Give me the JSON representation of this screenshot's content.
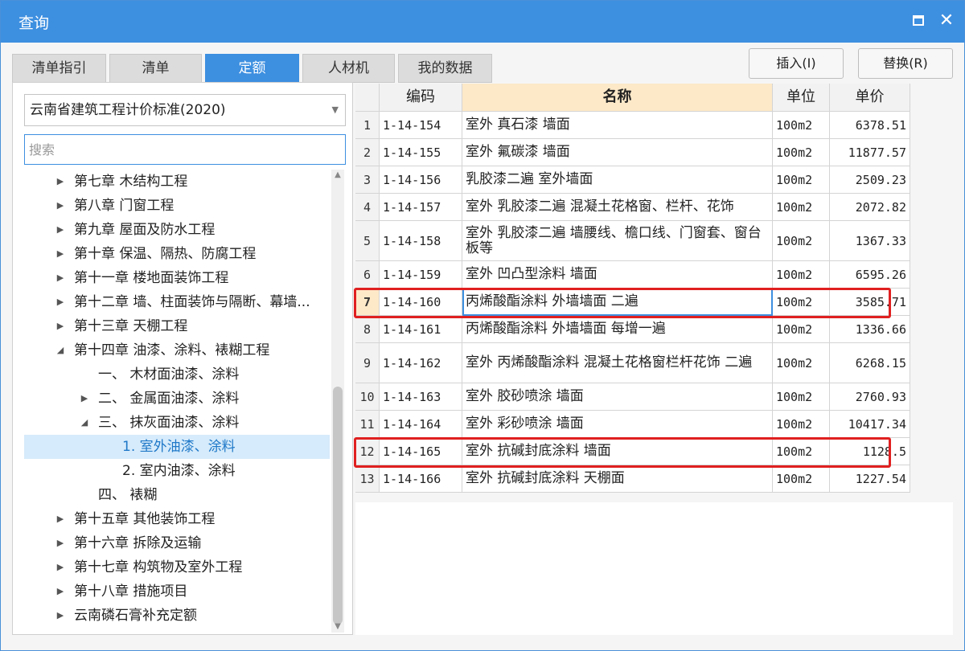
{
  "window": {
    "title": "查询"
  },
  "tabs": [
    "清单指引",
    "清单",
    "定额",
    "人材机",
    "我的数据"
  ],
  "active_tab": "定额",
  "buttons": {
    "insert": "插入(I)",
    "replace": "替换(R)"
  },
  "standard_select": "云南省建筑工程计价标准(2020)",
  "search": {
    "placeholder": "搜索",
    "value": ""
  },
  "tree": [
    {
      "label": "第七章 木结构工程",
      "level": 0,
      "expander": "right"
    },
    {
      "label": "第八章 门窗工程",
      "level": 0,
      "expander": "right"
    },
    {
      "label": "第九章 屋面及防水工程",
      "level": 0,
      "expander": "right"
    },
    {
      "label": "第十章 保温、隔热、防腐工程",
      "level": 0,
      "expander": "right"
    },
    {
      "label": "第十一章 楼地面装饰工程",
      "level": 0,
      "expander": "right"
    },
    {
      "label": "第十二章 墙、柱面装饰与隔断、幕墙...",
      "level": 0,
      "expander": "right"
    },
    {
      "label": "第十三章 天棚工程",
      "level": 0,
      "expander": "right"
    },
    {
      "label": "第十四章 油漆、涂料、裱糊工程",
      "level": 0,
      "expander": "down"
    },
    {
      "label": "一、 木材面油漆、涂料",
      "level": 1,
      "expander": "none"
    },
    {
      "label": "二、 金属面油漆、涂料",
      "level": 1,
      "expander": "right"
    },
    {
      "label": "三、 抹灰面油漆、涂料",
      "level": 1,
      "expander": "down"
    },
    {
      "label": "1. 室外油漆、涂料",
      "level": 2,
      "expander": "none",
      "selected": true
    },
    {
      "label": "2. 室内油漆、涂料",
      "level": 2,
      "expander": "none"
    },
    {
      "label": "四、 裱糊",
      "level": 1,
      "expander": "none"
    },
    {
      "label": "第十五章 其他装饰工程",
      "level": 0,
      "expander": "right"
    },
    {
      "label": "第十六章 拆除及运输",
      "level": 0,
      "expander": "right"
    },
    {
      "label": "第十七章 构筑物及室外工程",
      "level": 0,
      "expander": "right"
    },
    {
      "label": "第十八章 措施项目",
      "level": 0,
      "expander": "right"
    },
    {
      "label": "云南磷石膏补充定额",
      "level": 0,
      "expander": "right"
    }
  ],
  "table": {
    "headers": [
      "",
      "编码",
      "名称",
      "单位",
      "单价"
    ],
    "rows": [
      {
        "idx": "1",
        "code": "1-14-154",
        "name": "室外 真石漆 墙面",
        "unit": "100m2",
        "price": "6378.51"
      },
      {
        "idx": "2",
        "code": "1-14-155",
        "name": "室外 氟碳漆 墙面",
        "unit": "100m2",
        "price": "11877.57"
      },
      {
        "idx": "3",
        "code": "1-14-156",
        "name": "乳胶漆二遍 室外墙面",
        "unit": "100m2",
        "price": "2509.23"
      },
      {
        "idx": "4",
        "code": "1-14-157",
        "name": "室外 乳胶漆二遍 混凝土花格窗、栏杆、花饰",
        "unit": "100m2",
        "price": "2072.82"
      },
      {
        "idx": "5",
        "code": "1-14-158",
        "name": "室外 乳胶漆二遍 墙腰线、檐口线、门窗套、窗台板等",
        "unit": "100m2",
        "price": "1367.33"
      },
      {
        "idx": "6",
        "code": "1-14-159",
        "name": "室外 凹凸型涂料 墙面",
        "unit": "100m2",
        "price": "6595.26"
      },
      {
        "idx": "7",
        "code": "1-14-160",
        "name": "丙烯酸酯涂料 外墙墙面 二遍",
        "unit": "100m2",
        "price": "3585.71"
      },
      {
        "idx": "8",
        "code": "1-14-161",
        "name": "丙烯酸酯涂料 外墙墙面 每增一遍",
        "unit": "100m2",
        "price": "1336.66"
      },
      {
        "idx": "9",
        "code": "1-14-162",
        "name": "室外 丙烯酸酯涂料 混凝土花格窗栏杆花饰 二遍",
        "unit": "100m2",
        "price": "6268.15"
      },
      {
        "idx": "10",
        "code": "1-14-163",
        "name": "室外 胶砂喷涂 墙面",
        "unit": "100m2",
        "price": "2760.93"
      },
      {
        "idx": "11",
        "code": "1-14-164",
        "name": "室外 彩砂喷涂 墙面",
        "unit": "100m2",
        "price": "10417.34"
      },
      {
        "idx": "12",
        "code": "1-14-165",
        "name": "室外 抗碱封底涂料 墙面",
        "unit": "100m2",
        "price": "1128.5"
      },
      {
        "idx": "13",
        "code": "1-14-166",
        "name": "室外 抗碱封底涂料 天棚面",
        "unit": "100m2",
        "price": "1227.54"
      }
    ],
    "current_row": "7",
    "highlighted_rows": [
      "7",
      "12"
    ]
  },
  "colors": {
    "accent": "#3d8fe0",
    "header_highlight": "#fde9c8",
    "annotation": "#e02020"
  }
}
